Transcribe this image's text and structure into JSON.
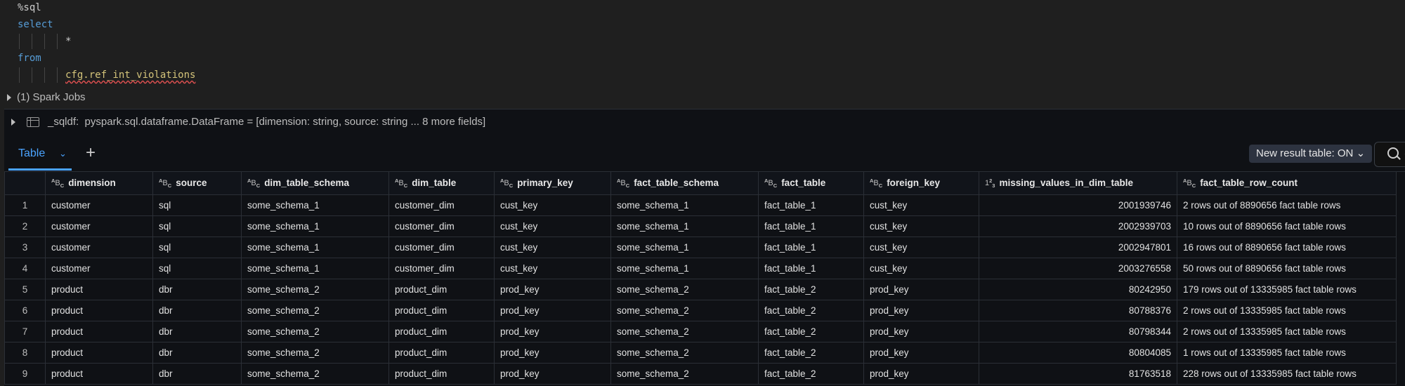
{
  "code": {
    "magic": "%sql",
    "select_kw": "select",
    "star": "*",
    "from_kw": "from",
    "table_ref": "cfg.ref_int_violations"
  },
  "spark_jobs": "(1) Spark Jobs",
  "dataframe": {
    "name": "_sqldf:",
    "type_desc": "pyspark.sql.dataframe.DataFrame = [dimension: string, source: string ... 8 more fields]"
  },
  "tabs": {
    "table_label": "Table",
    "add_label": "+",
    "new_result_label": "New result table: ON"
  },
  "columns": [
    {
      "name": "dimension",
      "type_icon": "string-type-icon"
    },
    {
      "name": "source",
      "type_icon": "string-type-icon"
    },
    {
      "name": "dim_table_schema",
      "type_icon": "string-type-icon"
    },
    {
      "name": "dim_table",
      "type_icon": "string-type-icon"
    },
    {
      "name": "primary_key",
      "type_icon": "string-type-icon"
    },
    {
      "name": "fact_table_schema",
      "type_icon": "string-type-icon"
    },
    {
      "name": "fact_table",
      "type_icon": "string-type-icon"
    },
    {
      "name": "foreign_key",
      "type_icon": "string-type-icon"
    },
    {
      "name": "missing_values_in_dim_table",
      "type_icon": "numeric-type-icon"
    },
    {
      "name": "fact_table_row_count",
      "type_icon": "string-type-icon"
    }
  ],
  "rows": [
    [
      "1",
      "customer",
      "sql",
      "some_schema_1",
      "customer_dim",
      "cust_key",
      "some_schema_1",
      "fact_table_1",
      "cust_key",
      "2001939746",
      "2 rows out of 8890656 fact table rows"
    ],
    [
      "2",
      "customer",
      "sql",
      "some_schema_1",
      "customer_dim",
      "cust_key",
      "some_schema_1",
      "fact_table_1",
      "cust_key",
      "2002939703",
      "10 rows out of 8890656 fact table rows"
    ],
    [
      "3",
      "customer",
      "sql",
      "some_schema_1",
      "customer_dim",
      "cust_key",
      "some_schema_1",
      "fact_table_1",
      "cust_key",
      "2002947801",
      "16 rows out of 8890656 fact table rows"
    ],
    [
      "4",
      "customer",
      "sql",
      "some_schema_1",
      "customer_dim",
      "cust_key",
      "some_schema_1",
      "fact_table_1",
      "cust_key",
      "2003276558",
      "50 rows out of 8890656 fact table rows"
    ],
    [
      "5",
      "product",
      "dbr",
      "some_schema_2",
      "product_dim",
      "prod_key",
      "some_schema_2",
      "fact_table_2",
      "prod_key",
      "80242950",
      "179 rows out of 13335985 fact table rows"
    ],
    [
      "6",
      "product",
      "dbr",
      "some_schema_2",
      "product_dim",
      "prod_key",
      "some_schema_2",
      "fact_table_2",
      "prod_key",
      "80788376",
      "2 rows out of 13335985 fact table rows"
    ],
    [
      "7",
      "product",
      "dbr",
      "some_schema_2",
      "product_dim",
      "prod_key",
      "some_schema_2",
      "fact_table_2",
      "prod_key",
      "80798344",
      "2 rows out of 13335985 fact table rows"
    ],
    [
      "8",
      "product",
      "dbr",
      "some_schema_2",
      "product_dim",
      "prod_key",
      "some_schema_2",
      "fact_table_2",
      "prod_key",
      "80804085",
      "1 rows out of 13335985 fact table rows"
    ],
    [
      "9",
      "product",
      "dbr",
      "some_schema_2",
      "product_dim",
      "prod_key",
      "some_schema_2",
      "fact_table_2",
      "prod_key",
      "81763518",
      "228 rows out of 13335985 fact table rows"
    ]
  ]
}
